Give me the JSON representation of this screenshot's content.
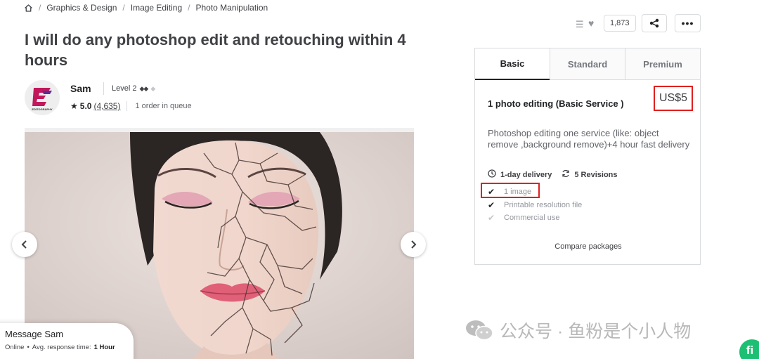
{
  "breadcrumb": {
    "icon": "home-icon",
    "items": [
      "Graphics & Design",
      "Image Editing",
      "Photo Manipulation"
    ],
    "separator": "/"
  },
  "gig": {
    "title": "I will do any photoshop edit and retouching within 4 hours"
  },
  "seller": {
    "name": "Sam",
    "level": "Level 2",
    "rating": "5.0",
    "reviews": "(4,635)",
    "queue": "1 order in queue",
    "avatar_text": "EDITOGRAPHY"
  },
  "actions": {
    "likes": "1,873",
    "more": "•••"
  },
  "packages": {
    "tabs": [
      "Basic",
      "Standard",
      "Premium"
    ],
    "active_tab": "Basic",
    "title": "1 photo editing (Basic Service )",
    "price": "US$5",
    "description": "Photoshop editing one service (like: object remove ,background remove)+4 hour fast delivery",
    "delivery": "1-day delivery",
    "revisions": "5 Revisions",
    "features": [
      {
        "label": "1 image",
        "included": true
      },
      {
        "label": "Printable resolution file",
        "included": true
      },
      {
        "label": "Commercial use",
        "included": false
      }
    ],
    "compare": "Compare packages"
  },
  "message": {
    "title": "Message Sam",
    "status": "Online",
    "bullet": "•",
    "response_label": "Avg. response time:",
    "response_value": "1 Hour"
  },
  "watermark": {
    "text": "公众号 · 鱼粉是个小人物"
  },
  "fab": {
    "label": "fi"
  },
  "colors": {
    "highlight": "#e0201f",
    "accent": "#1dbf73"
  }
}
